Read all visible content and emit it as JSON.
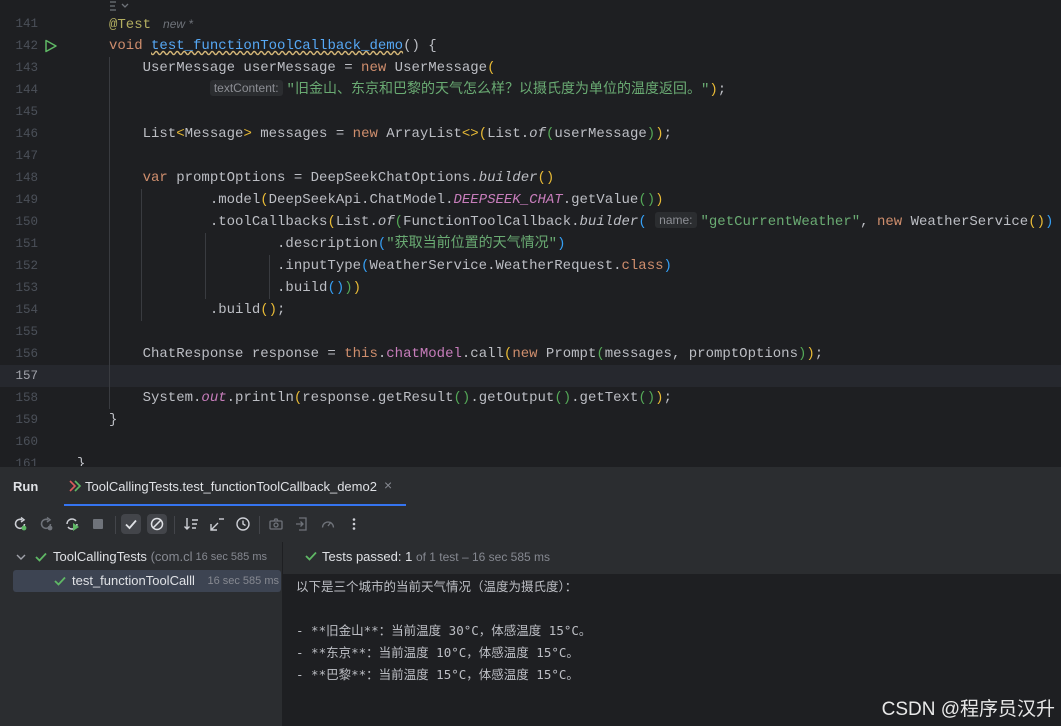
{
  "editor": {
    "lines": [
      {
        "n": "141",
        "html": "<span class=\"ann\">@Test</span><span class=\"new\">new *</span>"
      },
      {
        "n": "142",
        "html": "<span class=\"kw\">void</span> <span class=\"fn und\">test_functionToolCallback_demo</span>() {"
      },
      {
        "n": "143",
        "html": "    UserMessage userMessage = <span class=\"kw\">new</span> UserMessage<span class=\"p1\">(</span>"
      },
      {
        "n": "144",
        "html": "            <span class=\"hint\">textContent:</span><span class=\"str\">\"旧金山、东京和巴黎的天气怎么样？以摄氏度为单位的温度返回。\"</span><span class=\"p1\">)</span>;"
      },
      {
        "n": "145",
        "html": ""
      },
      {
        "n": "146",
        "html": "    List<span class=\"p1\">&lt;</span>Message<span class=\"p1\">&gt;</span> messages = <span class=\"kw\">new</span> ArrayList<span class=\"p1\">&lt;&gt;(</span>List.<span class=\"it\">of</span><span class=\"p2\">(</span>userMessage<span class=\"p2\">)</span><span class=\"p1\">)</span>;"
      },
      {
        "n": "147",
        "html": ""
      },
      {
        "n": "148",
        "html": "    <span class=\"kw\">var</span> promptOptions = DeepSeekChatOptions.<span class=\"it\">builder</span><span class=\"p1\">()</span>"
      },
      {
        "n": "149",
        "html": "            .model<span class=\"p1\">(</span>DeepSeekApi.ChatModel.<span class=\"fld it\">DEEPSEEK_CHAT</span>.getValue<span class=\"p2\">()</span><span class=\"p1\">)</span>"
      },
      {
        "n": "150",
        "html": "            .toolCallbacks<span class=\"p1\">(</span>List.<span class=\"it\">of</span><span class=\"p2\">(</span>FunctionToolCallback.<span class=\"it\">builder</span><span class=\"p3\">(</span> <span class=\"hint\">name:</span><span class=\"str\">\"getCurrentWeather\"</span>, <span class=\"kw\">new</span> WeatherService<span class=\"p1\">()</span><span class=\"p3\">)</span>"
      },
      {
        "n": "151",
        "html": "                    .description<span class=\"p3\">(</span><span class=\"str\">\"获取当前位置的天气情况\"</span><span class=\"p3\">)</span>"
      },
      {
        "n": "152",
        "html": "                    .inputType<span class=\"p3\">(</span>WeatherService.WeatherRequest.<span class=\"kw\">class</span><span class=\"p3\">)</span>"
      },
      {
        "n": "153",
        "html": "                    .build<span class=\"p3\">()</span><span class=\"p2\">)</span><span class=\"p1\">)</span>"
      },
      {
        "n": "154",
        "html": "            .build<span class=\"p1\">()</span>;"
      },
      {
        "n": "155",
        "html": ""
      },
      {
        "n": "156",
        "html": "    ChatResponse response = <span class=\"kw\">this</span>.<span class=\"fld\">chatModel</span>.call<span class=\"p1\">(</span><span class=\"kw\">new</span> Prompt<span class=\"p2\">(</span>messages, promptOptions<span class=\"p2\">)</span><span class=\"p1\">)</span>;"
      },
      {
        "n": "157",
        "html": ""
      },
      {
        "n": "158",
        "html": "    System.<span class=\"fld it\">out</span>.println<span class=\"p1\">(</span>response.getResult<span class=\"p2\">()</span>.getOutput<span class=\"p2\">()</span>.getText<span class=\"p2\">()</span><span class=\"p1\">)</span>;"
      },
      {
        "n": "159",
        "html": "}"
      },
      {
        "n": "160",
        "html": ""
      },
      {
        "n": "161",
        "html": "<span style=\"margin-left:-32px\">}</span>"
      }
    ]
  },
  "run_panel": {
    "title": "Run",
    "tab_label": "ToolCallingTests.test_functionToolCallback_demo2",
    "tab_close": "×"
  },
  "tree": {
    "root": {
      "name": "ToolCallingTests",
      "sub": "(com.cl",
      "time": "16 sec 585 ms"
    },
    "child": {
      "name": "test_functionToolCalll",
      "time": "16 sec 585 ms"
    }
  },
  "status": {
    "passed_label": "Tests passed: 1",
    "detail": "of 1 test – 16 sec 585 ms"
  },
  "console_lines": [
    "以下是三个城市的当前天气情况（温度为摄氏度）：",
    "",
    "- **旧金山**：当前温度 30°C，体感温度 15°C。",
    "- **东京**：当前温度 10°C，体感温度 15°C。",
    "- **巴黎**：当前温度 15°C，体感温度 15°C。"
  ],
  "watermark": "CSDN @程序员汉升",
  "colors": {
    "accent": "#3574f0",
    "pass_green": "#5fb865",
    "keyword": "#cf8e6d",
    "string": "#6aab73"
  }
}
